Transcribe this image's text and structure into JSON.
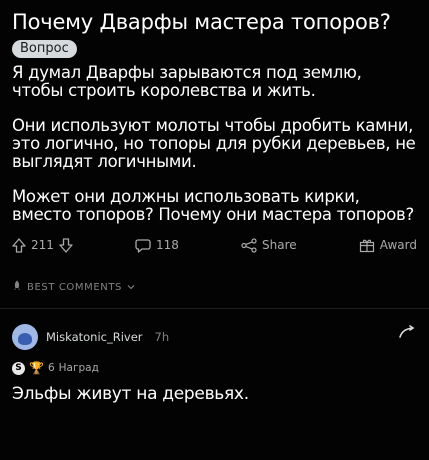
{
  "post": {
    "title": "Почему Дварфы мастера топоров?",
    "flair": "Вопрос",
    "paragraphs": [
      "Я думал Дварфы зарываются под землю, чтобы строить королевства и жить.",
      "Они используют молоты чтобы дробить камни, это логично, но топоры для рубки деревьев, не выглядят логичными.",
      "Может они должны использовать кирки, вместо топоров? Почему они мастера топоров?"
    ]
  },
  "actions": {
    "votes": "211",
    "comments": "118",
    "share_label": "Share",
    "award_label": "Award"
  },
  "sort": {
    "label": "BEST COMMENTS"
  },
  "comment": {
    "author": "Miskatonic_River",
    "time": "7h",
    "award_count": "6",
    "award_label": "Наград",
    "body": "Эльфы живут на деревьях."
  },
  "colors": {
    "background": "#030303",
    "text": "#ffffff",
    "muted": "#a8aaab",
    "flair_bg": "#d7dadc",
    "avatar": "#9fb8e6"
  }
}
